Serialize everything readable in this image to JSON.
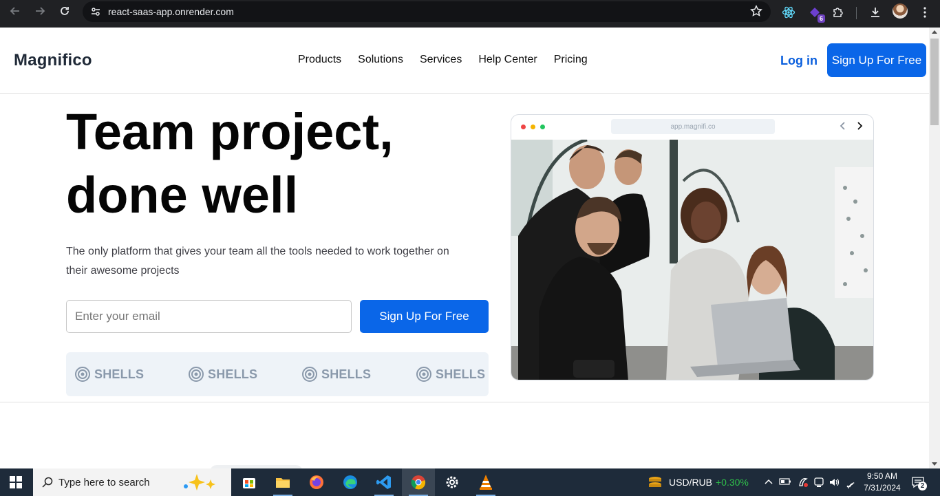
{
  "browser": {
    "url": "react-saas-app.onrender.com",
    "extension_badge": "6"
  },
  "header": {
    "logo": "Magnifico",
    "nav": [
      "Products",
      "Solutions",
      "Services",
      "Help Center",
      "Pricing"
    ],
    "login": "Log in",
    "signup": "Sign Up For Free"
  },
  "hero": {
    "title_line1": "Team project,",
    "title_line2": "done well",
    "subtitle": "The only platform that gives your team all the tools needed to work together on their awesome projects",
    "email_placeholder": "Enter your email",
    "cta": "Sign Up For Free",
    "partners": [
      "SHELLS",
      "SHELLS",
      "SHELLS",
      "SHELLS"
    ]
  },
  "mock_window": {
    "address": "app.magnifi.co",
    "dot_colors": [
      "#ef4444",
      "#f5b400",
      "#22c55e"
    ]
  },
  "taskbar": {
    "search_placeholder": "Type here to search",
    "ticker_pair": "USD/RUB",
    "ticker_change": "+0.30%",
    "ticker_color": "#2fbf4a",
    "time": "9:50 AM",
    "date": "7/31/2024",
    "notification_count": "2"
  }
}
